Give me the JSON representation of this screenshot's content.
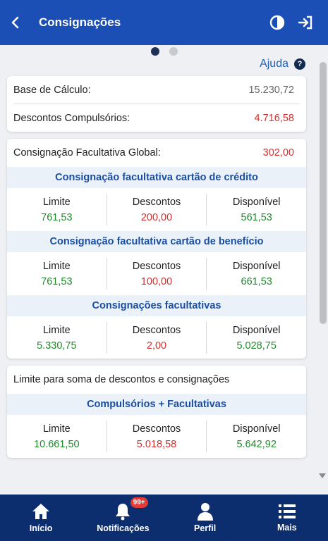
{
  "header": {
    "title": "Consignações"
  },
  "help": {
    "label": "Ajuda"
  },
  "summary": {
    "base_label": "Base de Cálculo:",
    "base_value": "15.230,72",
    "desc_label": "Descontos Compulsórios:",
    "desc_value": "4.716,58"
  },
  "global": {
    "label": "Consignação Facultativa Global:",
    "value": "302,00",
    "sections": [
      {
        "title": "Consignação facultativa cartão de crédito",
        "limite": "761,53",
        "descontos": "200,00",
        "disponivel": "561,53"
      },
      {
        "title": "Consignação facultativa cartão de benefício",
        "limite": "761,53",
        "descontos": "100,00",
        "disponivel": "661,53"
      },
      {
        "title": "Consignações facultativas",
        "limite": "5.330,75",
        "descontos": "2,00",
        "disponivel": "5.028,75"
      }
    ]
  },
  "columns": {
    "limite": "Limite",
    "descontos": "Descontos",
    "disponivel": "Disponível"
  },
  "limit_card": {
    "title": "Limite para soma de descontos e consignações",
    "section_title": "Compulsórios + Facultativas",
    "limite": "10.661,50",
    "descontos": "5.018,58",
    "disponivel": "5.642,92"
  },
  "nav": {
    "inicio": "Início",
    "notificacoes": "Notificações",
    "notif_badge": "99+",
    "perfil": "Perfil",
    "mais": "Mais"
  },
  "colors": {
    "primary": "#1b4fb6",
    "nav_bg": "#0d2e6e",
    "green": "#1e8a2a",
    "red": "#d32f2f"
  }
}
